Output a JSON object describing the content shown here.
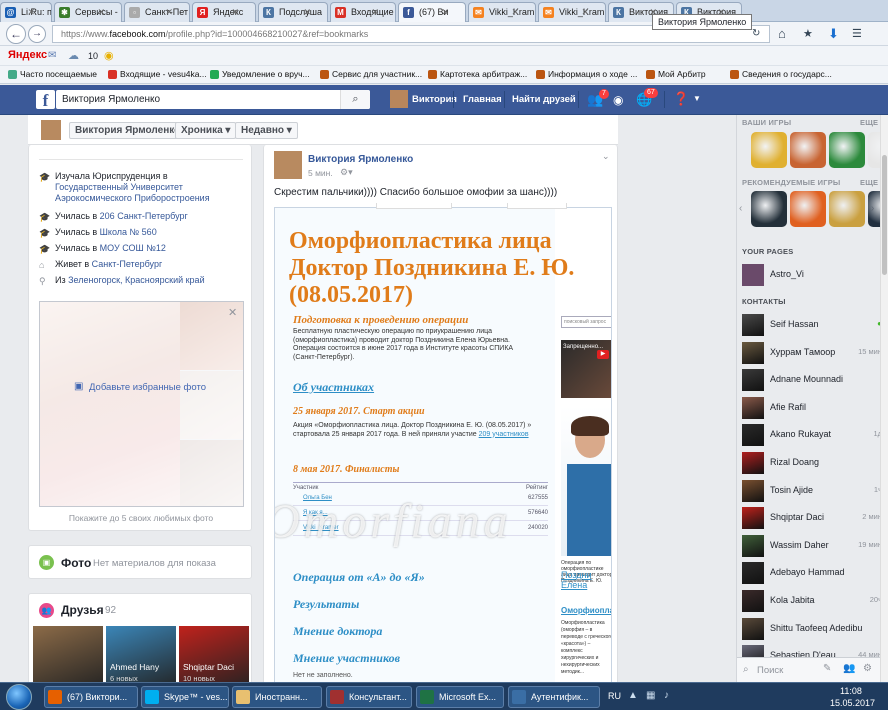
{
  "browser": {
    "tabs": [
      {
        "label": "Li.Ru: по",
        "icon": "mailru",
        "color": "#1a5fb4",
        "glyph": "@"
      },
      {
        "label": "Сервисы -",
        "icon": "services",
        "color": "#3a7d2c",
        "glyph": "✱"
      },
      {
        "label": "Санкт-Пет",
        "icon": "page",
        "color": "#aaaaaa",
        "glyph": "▫"
      },
      {
        "label": "Яндекс",
        "icon": "yandex",
        "color": "#e02020",
        "glyph": "Я"
      },
      {
        "label": "Подслуша",
        "icon": "vk",
        "color": "#4c75a3",
        "glyph": "К"
      },
      {
        "label": "Входящие",
        "icon": "gmail",
        "color": "#d93025",
        "glyph": "M"
      },
      {
        "label": "(67) Ви",
        "icon": "facebook",
        "color": "#3b5998",
        "glyph": "f"
      },
      {
        "label": "Vikki_Kram",
        "icon": "ok",
        "color": "#f58220",
        "glyph": "✉"
      },
      {
        "label": "Vikki_Kram",
        "icon": "ok",
        "color": "#f58220",
        "glyph": "✉"
      },
      {
        "label": "Виктория",
        "icon": "vk",
        "color": "#4c75a3",
        "glyph": "К"
      },
      {
        "label": "Виктория",
        "icon": "vk",
        "color": "#4c75a3",
        "glyph": "К"
      }
    ],
    "tooltip": "Виктория Ярмоленко",
    "url_prefix": "https://www.",
    "url_domain": "facebook.com",
    "url_rest": "/profile.php?id=100004668210027&ref=bookmarks",
    "yandex_label": "Яндекс",
    "weather": "10",
    "bookmarks": [
      {
        "label": "Часто посещаемые",
        "color": "#4a8"
      },
      {
        "label": "Входящие - vesu4ka...",
        "color": "#d93025"
      },
      {
        "label": "Уведомление о вруч...",
        "color": "#2a5"
      },
      {
        "label": "Сервис для участник...",
        "color": "#b51"
      },
      {
        "label": "Картотека арбитраж...",
        "color": "#b51"
      },
      {
        "label": "Информация о ходе ...",
        "color": "#b51"
      },
      {
        "label": "Мой Арбитр",
        "color": "#b51"
      },
      {
        "label": "Сведения о государс...",
        "color": "#b51"
      }
    ]
  },
  "fb": {
    "search_value": "Виктория Ярмоленко",
    "user_name": "Виктория",
    "nav_home": "Главная",
    "nav_find_friends": "Найти друзей",
    "badge_friends": "7",
    "badge_notifications": "67",
    "accent": "#3b5998"
  },
  "profile": {
    "name": "Виктория Ярмоленко",
    "timeline_btn": "Хроника",
    "recent_btn": "Недавно",
    "intro": [
      {
        "icon": "education-icon",
        "pre": "Изучала Юриспруденция в ",
        "link": "Государственный Университет Аэрокосмического Приборостроения"
      },
      {
        "icon": "school-icon",
        "pre": "Училась в ",
        "link": "206 Санкт-Петербург"
      },
      {
        "icon": "school-icon",
        "pre": "Училась в ",
        "link": "Школа № 560"
      },
      {
        "icon": "school-icon",
        "pre": "Училась в ",
        "link": "МОУ СОШ №12"
      },
      {
        "icon": "home-icon",
        "pre": "Живет в ",
        "link": "Санкт-Петербург"
      },
      {
        "icon": "location-icon",
        "pre": "Из ",
        "link": "Зеленогорск, Красноярский край"
      }
    ],
    "featured_add": "Добавьте избранные фото",
    "featured_hint": "Покажите до 5 своих любимых фото",
    "photos_title": "Фото",
    "photos_empty": "Нет материалов для показа",
    "friends_title": "Друзья",
    "friends_count": "92",
    "friends": [
      {
        "name": "",
        "sub": "",
        "color": "#8c6b48"
      },
      {
        "name": "Ahmed Hany",
        "sub": "6 новых",
        "color": "#3b86b8"
      },
      {
        "name": "Shqiptar Daci",
        "sub": "10 новых",
        "color": "#c0221c"
      }
    ]
  },
  "post": {
    "author": "Виктория Ярмоленко",
    "time": "5 мин.",
    "text": "Скрестим пальчики)))) Спасибо большое омофии за шанс))))",
    "img_title1": "Оморфиопластика лица",
    "img_title2": "Доктор Поздникина Е. Ю.",
    "img_title3": "(08.05.2017)",
    "img_section1": "Подготовка к проведению операции",
    "img_para1": "Бесплатную пластическую операцию по приукрашению лица (оморфиопластика) проводит доктор Поздникина Елена Юрьевна. Операция состоится в июне 2017 года в Институте красоты СПИКА (Санкт-Петербург).",
    "img_section2": "Об участниках",
    "img_date1": "25 января 2017. Старт акции",
    "img_para2_pre": "Акция «Оморфиопластика лица. Доктор Поздникина Е. Ю. (08.05.2017) » стартовала 25 января 2017 года. В ней приняли участие ",
    "img_para2_link": "209 участников",
    "img_date2": "8 мая 2017. Финалисты",
    "tbl_head_left": "Участник",
    "tbl_head_right": "Рейтинг",
    "tbl_rows": [
      {
        "name": "Ольга Бен",
        "score": "627555"
      },
      {
        "name": "Я как я...",
        "score": "576640"
      },
      {
        "name": "Vikki_Kramer",
        "score": "240020"
      }
    ],
    "img_links": [
      "Операция от «А» до «Я»",
      "Результаты",
      "Мнение доктора",
      "Мнение участников"
    ],
    "img_footer": "Нет не заполнено.",
    "side_search": "поисковый запрос",
    "side_video": "Запрещенно...",
    "side_caption": "Операция по оморфиопластике лица проводит доктор Поздникина Е. Ю.",
    "side_link": "Поздни\nЕлена",
    "side_title2": "Оморфиопластика",
    "side_para2": "Оморфиопластика (оморфия – в переводе с греческого «красота») – комплекс хирургических и нехирургических методик...",
    "watermark": "Omorfiana"
  },
  "right": {
    "games_title": "ВАШИ ИГРЫ",
    "more": "ЕЩЕ",
    "games": [
      {
        "color": "#e0b030",
        "name": "angry-birds"
      },
      {
        "color": "#c86432",
        "name": "game"
      },
      {
        "color": "#2c8a3c",
        "name": "game"
      },
      {
        "color": "#e6e6e6",
        "name": "game"
      }
    ],
    "recommended_title": "РЕКОМЕНДУЕМЫЕ ИГРЫ",
    "recommended": [
      {
        "color": "#24303a",
        "name": "aces"
      },
      {
        "color": "#e06020",
        "name": "game"
      },
      {
        "color": "#caa040",
        "name": "game"
      },
      {
        "color": "#223040",
        "name": "cops"
      }
    ],
    "pages_title": "YOUR PAGES",
    "pages": [
      {
        "name": "Astro_Vi",
        "color": "#6a4a6a"
      }
    ],
    "contacts_title": "КОНТАКТЫ",
    "contacts": [
      {
        "name": "Seif Hassan",
        "status": "●",
        "color": "#4a4a4a"
      },
      {
        "name": "Хуррам Тамоор",
        "status": "15 мин",
        "color": "#6a5a40"
      },
      {
        "name": "Adnane Mounnadi",
        "status": "",
        "color": "#3a3a3a"
      },
      {
        "name": "Afie Rafil",
        "status": "",
        "color": "#8a5a4a"
      },
      {
        "name": "Akano Rukayat",
        "status": "1д",
        "color": "#2a2a2a"
      },
      {
        "name": "Rizal Doang",
        "status": "",
        "color": "#b02020"
      },
      {
        "name": "Tosin Ajide",
        "status": "1ч",
        "color": "#7a5030"
      },
      {
        "name": "Shqiptar Daci",
        "status": "2 мин",
        "color": "#c0221c"
      },
      {
        "name": "Wassim Daher",
        "status": "19 мин",
        "color": "#40603a"
      },
      {
        "name": "Adebayo Hammad",
        "status": "",
        "color": "#2a2a2a"
      },
      {
        "name": "Kola Jabita",
        "status": "20ч",
        "color": "#3a2a2a"
      },
      {
        "name": "Shittu Taofeeq Adedibu",
        "status": "",
        "color": "#5a4a3a"
      },
      {
        "name": "Sebastien D'eau",
        "status": "44 мин",
        "color": "#6a6a7a"
      }
    ],
    "chat_search": "Поиск"
  },
  "taskbar": {
    "items": [
      {
        "label": "(67) Виктори...",
        "color": "#e66000"
      },
      {
        "label": "Skype™ - ves...",
        "color": "#00aff0"
      },
      {
        "label": "Иностранн...",
        "color": "#e8c070"
      },
      {
        "label": "Консультант...",
        "color": "#a03030"
      },
      {
        "label": "Microsoft Ex...",
        "color": "#1f7244"
      },
      {
        "label": "Аутентифик...",
        "color": "#3a6ea5"
      }
    ],
    "lang": "RU",
    "time": "11:08",
    "date": "15.05.2017"
  }
}
